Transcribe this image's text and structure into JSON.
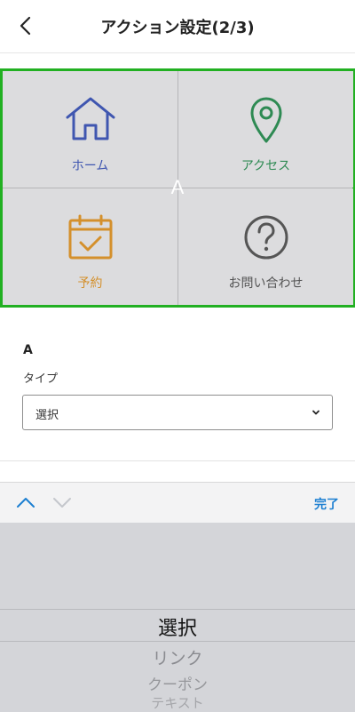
{
  "header": {
    "title": "アクション設定(2/3)",
    "back_icon": "chevron-left-icon"
  },
  "grid": {
    "overlay_letter": "A",
    "border_color": "#22b022",
    "tiles": [
      {
        "label": "ホーム",
        "icon": "home-icon",
        "color": "#3f56b0"
      },
      {
        "label": "アクセス",
        "icon": "map-pin-icon",
        "color": "#2e8a53"
      },
      {
        "label": "予約",
        "icon": "calendar-check-icon",
        "color": "#d4902c"
      },
      {
        "label": "お問い合わせ",
        "icon": "question-circle-icon",
        "color": "#555555"
      }
    ]
  },
  "form": {
    "section_label": "A",
    "type_label": "タイプ",
    "select_value": "選択"
  },
  "toolbar": {
    "done_label": "完了",
    "accent": "#1c7fd1"
  },
  "picker": {
    "selected": "選択",
    "options": [
      "リンク",
      "クーポン",
      "テキスト"
    ]
  }
}
